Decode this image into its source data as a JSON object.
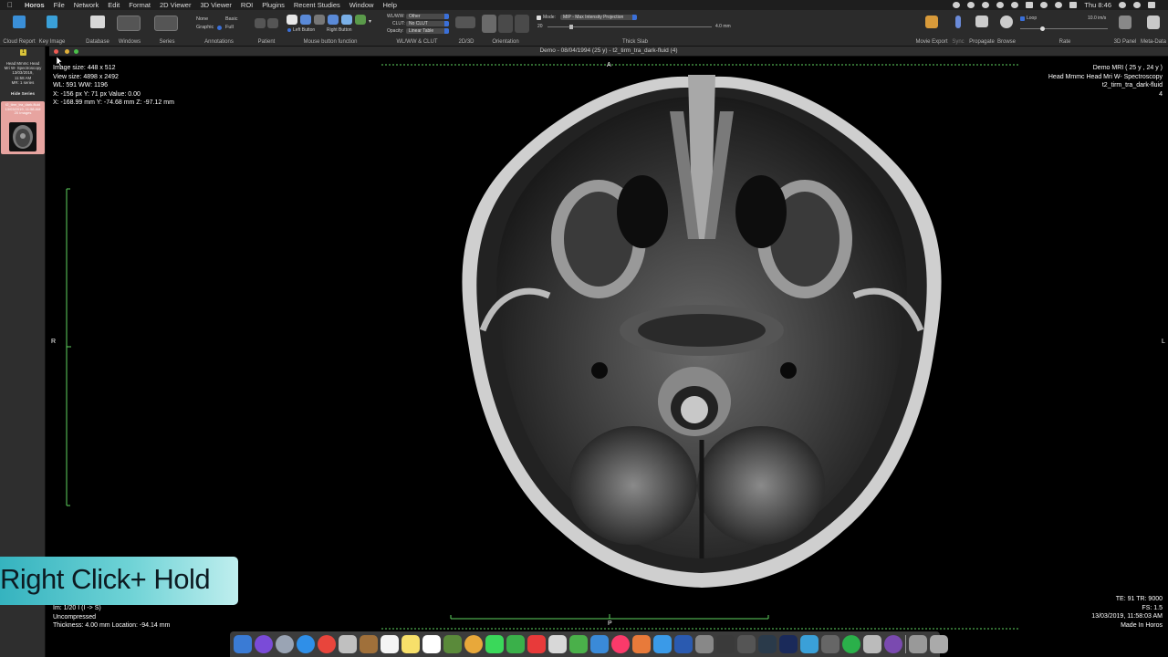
{
  "menubar": {
    "app": "Horos",
    "items": [
      "File",
      "Network",
      "Edit",
      "Format",
      "2D Viewer",
      "3D Viewer",
      "ROI",
      "Plugins",
      "Recent Studies",
      "Window",
      "Help"
    ],
    "clock": "Thu 8:46"
  },
  "toolbar": {
    "cloud_report": "Cloud Report",
    "key_image": "Key Image",
    "database": "Database",
    "windows": "Windows",
    "series": "Series",
    "annotations": {
      "label": "Annotations",
      "none": "None",
      "graphic": "Graphic",
      "basic": "Basic",
      "full": "Full"
    },
    "patient": "Patient",
    "mouse": {
      "label": "Mouse button function",
      "left": "Left Button",
      "right": "Right Button"
    },
    "wlww": {
      "label": "WL/WW & CLUT",
      "wlww_label": "WL/WW:",
      "wlww_value": "Other",
      "clut_label": "CLUT:",
      "clut_value": "No CLUT",
      "opacity_label": "Opacity:",
      "opacity_value": "Linear Table"
    },
    "view2d3d": "2D/3D",
    "orientation": "Orientation",
    "thickslab": {
      "label": "Thick Slab",
      "mode_label": "Mode:",
      "mode_value": "MIP - Max Intensity Projection",
      "count": "20",
      "thickness": "4.0 mm"
    },
    "movie_export": "Movie Export",
    "sync": "Sync",
    "propagate": "Propagate",
    "browse": "Browse",
    "rate": {
      "label": "Rate",
      "loop": "Loop",
      "value": "10.0 im/s",
      "level": 0.25
    },
    "panel3d": "3D Panel",
    "metadata": "Meta-Data"
  },
  "left_panel": {
    "number": "1",
    "study_lines": [
      "Head Mmmc Head",
      "Mri W- Spectroscopy",
      "13/03/2019,",
      "11:58 AM",
      "MR: 1 series"
    ],
    "hide_series": "Hide Series",
    "series_lines": [
      "t2_tirm_tra_dark-fluid",
      "13/03/2019, 11:58 AM",
      "20 Images"
    ]
  },
  "window_title": "Demo - 08/04/1994 (25 y) - t2_tirm_tra_dark-fluid (4)",
  "overlay": {
    "top_left": [
      "Image size: 448 x 512",
      "View size: 4898 x 2492",
      "WL: 591 WW: 1196",
      "X: -156 px Y: 71 px Value: 0.00",
      "X: -168.99 mm Y: -74.68 mm Z: -97.12 mm"
    ],
    "top_right": [
      "Demo MRI ( 25 y , 24 y )",
      "Head Mmmc Head Mri W- Spectroscopy",
      "t2_tirm_tra_dark-fluid",
      "4"
    ],
    "bottom_left": [
      "Im: 1/20  I (I -> S)",
      "Uncompressed",
      "Thickness: 4.00 mm Location: -94.14 mm"
    ],
    "bottom_right": [
      "TE: 91 TR: 9000",
      "FS: 1.5",
      "13/03/2019, 11:58:03 AM",
      "Made In Horos"
    ],
    "orient_top": "A",
    "orient_left": "R",
    "orient_right": "L",
    "orient_bottom": "P"
  },
  "caption": "Right Click+ Hold",
  "colors": {
    "accent_blue": "#3a6fd8",
    "measure_green": "#5fd35f",
    "series_card": "#e7a4a0",
    "caption_teal": "#35b3bf"
  }
}
